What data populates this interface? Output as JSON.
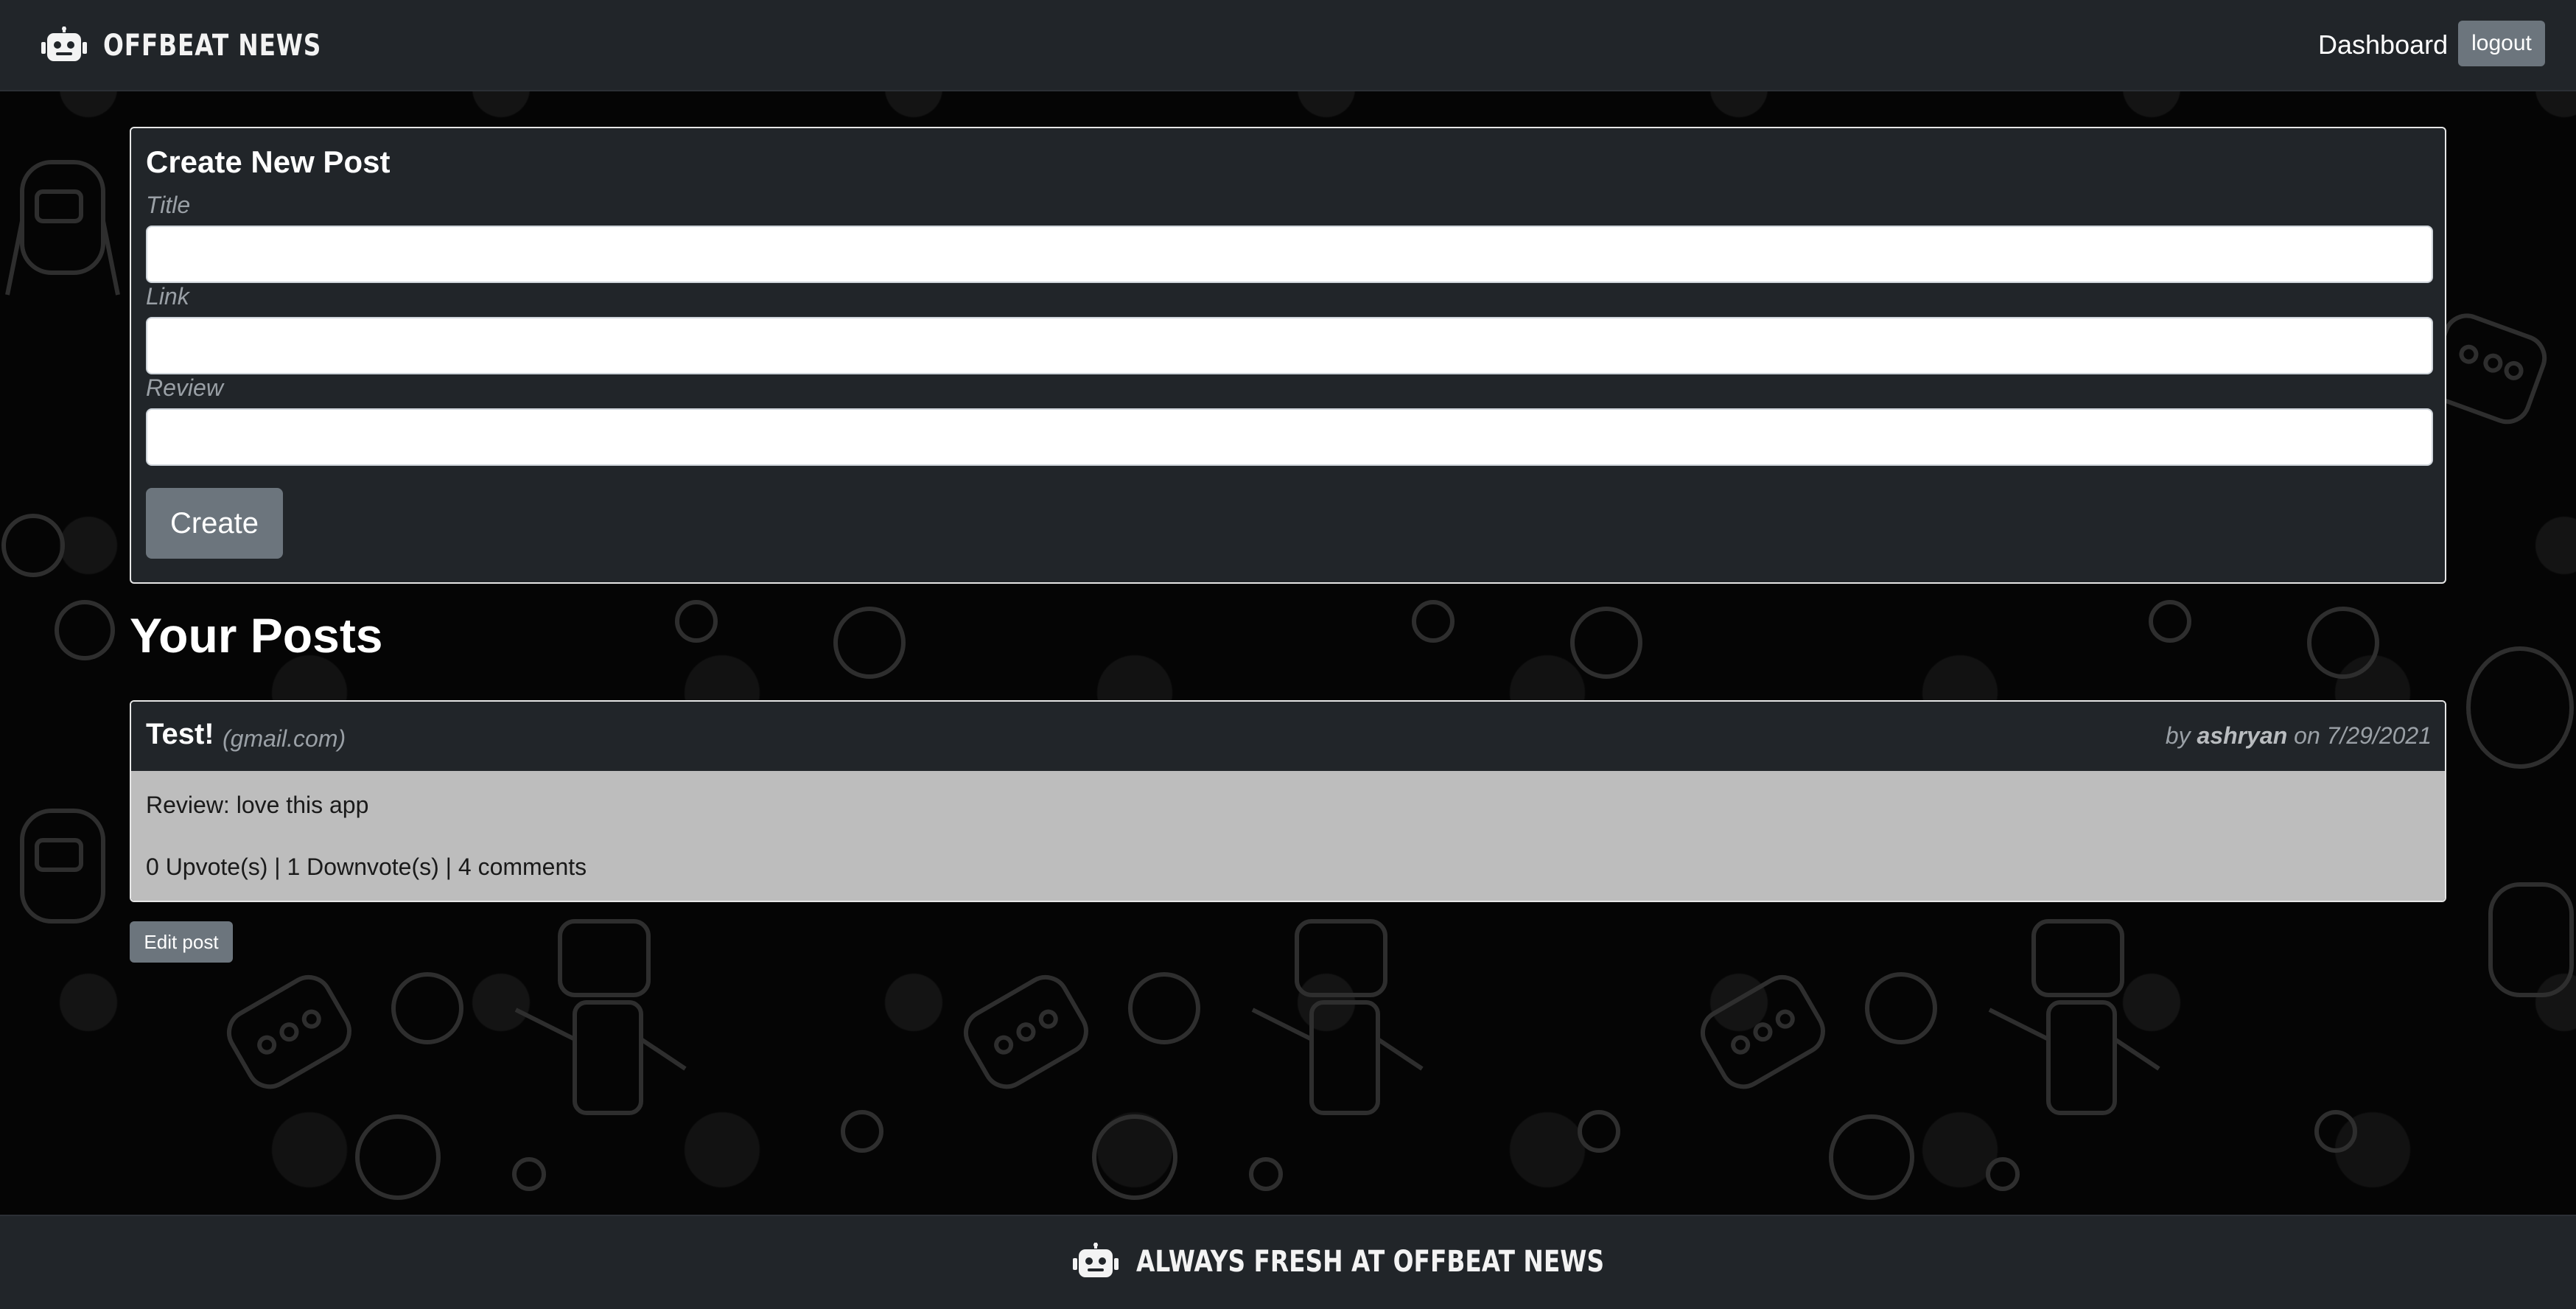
{
  "navbar": {
    "brand_icon": "robot-icon",
    "brand": "OFFBEAT NEWS",
    "dashboard_link": "Dashboard",
    "logout_button": "logout"
  },
  "create_form": {
    "heading": "Create New Post",
    "fields": [
      {
        "label": "Title",
        "value": ""
      },
      {
        "label": "Link",
        "value": ""
      },
      {
        "label": "Review",
        "value": ""
      }
    ],
    "submit_button": "Create"
  },
  "posts_section": {
    "heading": "Your Posts",
    "posts": [
      {
        "title": "Test!",
        "domain": "(gmail.com)",
        "by_prefix": "by",
        "author": "ashryan",
        "on_prefix": "on",
        "date": "7/29/2021",
        "review": "Review: love this app",
        "votes": "0 Upvote(s) | 1 Downvote(s) | ",
        "comments_link": "4 comments",
        "edit_button": "Edit post"
      }
    ]
  },
  "footer": {
    "icon": "robot-icon",
    "text": "ALWAYS FRESH AT OFFBEAT NEWS"
  },
  "colors": {
    "navbar_bg": "#212529",
    "page_bg": "#050505",
    "button_secondary": "#6c757d",
    "post_body_bg": "#bdbdbd"
  }
}
